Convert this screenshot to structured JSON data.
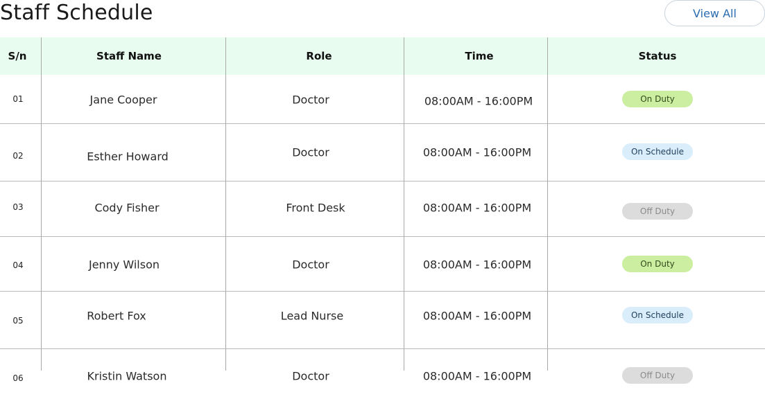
{
  "header": {
    "title": "Staff Schedule",
    "view_all_label": "View All"
  },
  "table": {
    "columns": [
      "S/n",
      "Staff Name",
      "Role",
      "Time",
      "Status"
    ],
    "rows": [
      {
        "sn": "01",
        "name": "Jane Cooper",
        "role": "Doctor",
        "time": "08:00AM - 16:00PM",
        "status": "On Duty",
        "status_type": "onduty"
      },
      {
        "sn": "02",
        "name": "Esther Howard",
        "role": "Doctor",
        "time": "08:00AM - 16:00PM",
        "status": "On Schedule",
        "status_type": "onschedule"
      },
      {
        "sn": "03",
        "name": "Cody Fisher",
        "role": "Front Desk",
        "time": "08:00AM - 16:00PM",
        "status": "Off Duty",
        "status_type": "offduty"
      },
      {
        "sn": "04",
        "name": "Jenny Wilson",
        "role": "Doctor",
        "time": "08:00AM - 16:00PM",
        "status": "On Duty",
        "status_type": "onduty"
      },
      {
        "sn": "05",
        "name": "Robert Fox",
        "role": "Lead Nurse",
        "time": "08:00AM - 16:00PM",
        "status": "On Schedule",
        "status_type": "onschedule"
      },
      {
        "sn": "06",
        "name": "Kristin Watson",
        "role": "Doctor",
        "time": "08:00AM - 16:00PM",
        "status": "Off Duty",
        "status_type": "offduty"
      }
    ]
  },
  "colors": {
    "header_bg": "#e8fcef",
    "on_duty": "#cceea0",
    "on_schedule": "#d9edfb",
    "off_duty": "#dcdcdc",
    "link": "#2a6db0"
  }
}
